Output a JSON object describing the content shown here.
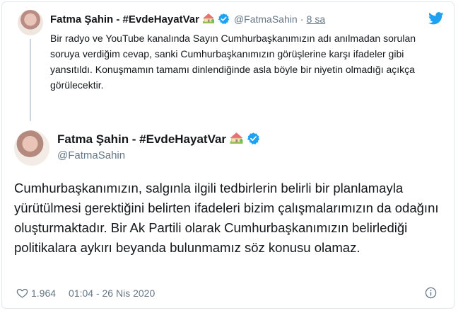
{
  "reply_tweet": {
    "name": "Fatma Şahin - #EvdeHayatVar",
    "handle": "@FatmaSahin",
    "separator": "·",
    "time": "8 sa",
    "text": "Bir radyo ve YouTube kanalında Sayın Cumhurbaşkanımızın adı anılmadan sorulan soruya verdiğim cevap, sanki Cumhurbaşkanımızın görüşlerine karşı ifadeler gibi yansıtıldı. Konuşmamın tamamı dinlendiğinde asla böyle bir niyetin olmadığı açıkça görülecektir."
  },
  "main_tweet": {
    "name": "Fatma Şahin - #EvdeHayatVar",
    "handle": "@FatmaSahin",
    "text": "Cumhurbaşkanımızın, salgınla ilgili tedbirlerin belirli bir planlamayla yürütülmesi gerektiğini belirten ifadeleri bizim çalışmalarımızın da odağını oluşturmaktadır. Bir Ak Partili olarak Cumhurbaşkanımızın belirlediği politikalara aykırı beyanda bulunmamız söz konusu olamaz.",
    "likes": "1.964",
    "timestamp": "01:04 - 26 Nis 2020"
  },
  "icons": {
    "emoji": "house-with-garden-icon",
    "verified": "verified-badge-icon",
    "brand": "twitter-bird-icon",
    "like": "heart-icon",
    "info": "info-icon"
  },
  "colors": {
    "brand": "#1da1f2",
    "secondary_text": "#657786",
    "border": "#e1e8ed"
  }
}
